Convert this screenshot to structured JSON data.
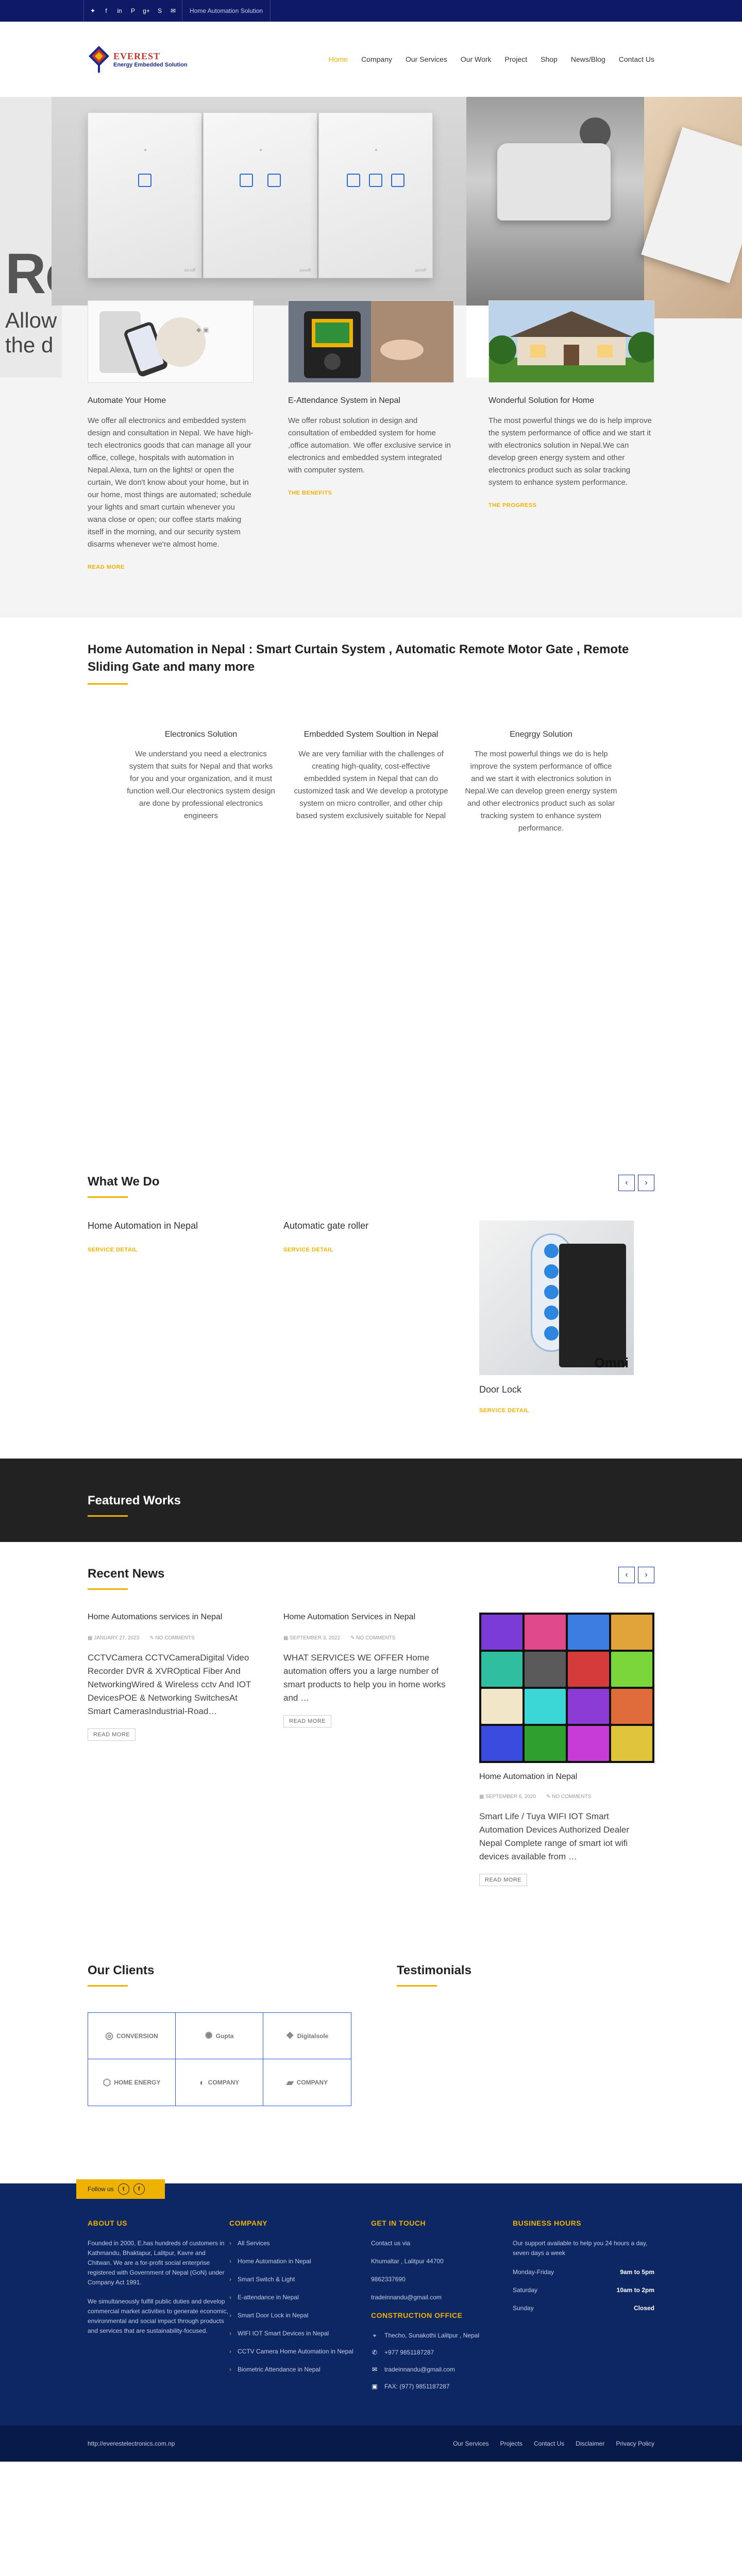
{
  "topbar": {
    "social_icons": [
      "twitter-icon",
      "facebook-icon",
      "linkedin-icon",
      "pinterest-icon",
      "googleplus-icon",
      "skype-icon",
      "email-icon"
    ],
    "social_glyphs": [
      "✦",
      "f",
      "in",
      "P",
      "g+",
      "S",
      "✉"
    ],
    "tagline": "Home Automation Solution"
  },
  "header": {
    "logo_title": "EVEREST",
    "logo_subtitle": "Energy Embedded Solution",
    "nav": [
      "Home",
      "Company",
      "Our Services",
      "Our Work",
      "Project",
      "Shop",
      "News/Blog",
      "Contact Us"
    ],
    "active_nav": "Home"
  },
  "hero": {
    "headline": "Re",
    "subline1": "Allow",
    "subline2": "the d",
    "switch_brand": "sonoff"
  },
  "features": [
    {
      "title": "Automate Your Home",
      "text": "We offer all electronics and embedded system design and consultation in Nepal. We have high-tech electronics goods that can manage all your office, college, hospitals with automation in Nepal.Alexa, turn on the lights! or open the curtain, We don't know about your home, but in our home, most things are automated; schedule your lights and smart curtain whenever you wana close or open; our coffee starts making itself in the morning, and our security system disarms whenever we're almost home.",
      "link": "READ MORE"
    },
    {
      "title": "E-Attendance System in Nepal",
      "text": "We offer robust solution in design and consultation of embedded system for home ,office automation. We offer exclusive service in electronics and embedded system integrated with computer system.",
      "link": "THE BENEFITS"
    },
    {
      "title": "Wonderful Solution for Home",
      "text": "The most powerful things we do is help improve the system performance of office and we start it with electronics solution in Nepal.We can develop green energy system and other electronics product such as solar tracking system to enhance system performance.",
      "link": "THE PROGRESS"
    }
  ],
  "about": {
    "heading": "Home Automation in Nepal : Smart Curtain System , Automatic Remote Motor Gate , Remote Sliding Gate and many more",
    "columns": [
      {
        "title": "Electronics Solution",
        "text": "We understand you need a electronics system that suits for Nepal and that works for you and your organization, and it must function well.Our electronics system design are done by professional electronics engineers"
      },
      {
        "title": "Embedded System Soultion in Nepal",
        "text": "We are very familiar with the challenges of creating high-quality, cost-effective embedded system in Nepal that can do customized task and We develop a prototype system on micro controller, and other chip based system exclusively suitable for Nepal"
      },
      {
        "title": "Enegrgy Solution",
        "text": "The most powerful things we do is help improve the system performance of office and we start it with electronics solution in Nepal.We can develop green energy system and other electronics product such as solar tracking system to enhance system performance."
      }
    ]
  },
  "what_we_do": {
    "title": "What We Do",
    "items": [
      {
        "title": "Home Automation in Nepal",
        "link": "SERVICE DETAIL"
      },
      {
        "title": "Automatic gate roller",
        "link": "SERVICE DETAIL"
      },
      {
        "title": "Door Lock",
        "link": "SERVICE DETAIL",
        "image_label": "Omni"
      }
    ],
    "prev": "‹",
    "next": "›"
  },
  "featured_works": {
    "title": "Featured Works"
  },
  "recent_news": {
    "title": "Recent News",
    "items": [
      {
        "title": "Home Automations services in Nepal",
        "date": "JANUARY 27, 2023",
        "comments": "NO COMMENTS",
        "text": "CCTVCamera CCTVCameraDigital Video Recorder DVR & XVROptical Fiber And NetworkingWired & Wireless cctv And IOT DevicesPOE & Networking SwitchesAt Smart CamerasIndustrial-Road…",
        "button": "READ MORE"
      },
      {
        "title": "Home Automation Services in Nepal",
        "date": "SEPTEMBER 3, 2022",
        "comments": "NO COMMENTS",
        "text": "WHAT SERVICES WE OFFER Home automation offers you a large number of smart products to help you in home works and …",
        "button": "READ MORE"
      },
      {
        "title": "Home Automation in Nepal",
        "date": "SEPTEMBER 6, 2020",
        "comments": "NO COMMENTS",
        "text": "Smart Life / Tuya WIFI IOT Smart Automation Devices  Authorized Dealer Nepal Complete range of smart iot wifi devices available from …",
        "button": "READ MORE"
      }
    ]
  },
  "clients": {
    "title": "Our Clients",
    "logos": [
      "CONVERSION",
      "Gupta",
      "Digitalsole",
      "HOME ENERGY",
      "COMPANY",
      "COMPANY"
    ]
  },
  "testimonials": {
    "title": "Testimonials"
  },
  "footer": {
    "follow_label": "Follow us",
    "follow_icons": [
      "t",
      "f"
    ],
    "about": {
      "title": "ABOUT US",
      "p1": "Founded in 2000, E.has hundreds of customers in Kathmandu, Bhaktapur, Lalitpur, Kavre and Chitwan. We are a for-profit social enterprise registered with Government of Nepal (GoN) under Company Act 1991.",
      "p2": "We simultaneously fulfill public duties and develop commercial market activities to generate economic, environmental and social impact through products and services that are sustainability-focused."
    },
    "company": {
      "title": "COMPANY",
      "links": [
        "All Services",
        "Home Automation in Nepal",
        "Smart Switch & Light",
        "E-attendance in Nepal",
        "Smart Door Lock in Nepal",
        "WIFI IOT Smart Devices in Nepal",
        "CCTV Camera Home Automation in Nepal",
        "Biometric Attendance in Nepal"
      ]
    },
    "contact": {
      "title": "GET IN TOUCH",
      "lines": [
        "Contact us via",
        "Khumaltar , Lalitpur 44700",
        "9862337690",
        "tradeinnandu@gmail.com"
      ],
      "construction_title": "CONSTRUCTION OFFICE",
      "address": "Thecho, Sunakothi Lalitpur , Nepal",
      "phone": "+977 9851187287",
      "email": "tradeinnandu@gmail.com",
      "fax": "FAX: (977) 9851187287"
    },
    "hours": {
      "title": "BUSINESS HOURS",
      "intro": "Our support available to help you 24 hours a day, seven days a week",
      "rows": [
        {
          "day": "Monday-Friday",
          "time": "9am to 5pm"
        },
        {
          "day": "Saturday",
          "time": "10am to 2pm"
        },
        {
          "day": "Sunday",
          "time": "Closed"
        }
      ]
    }
  },
  "bottombar": {
    "url": "http://everestelectronics.com.np",
    "links": [
      "Our Services",
      "Projects",
      "Contact Us",
      "Disclaimer",
      "Privacy Policy"
    ]
  },
  "colors": {
    "topbar": "#0e1a66",
    "accent": "#f0b200",
    "footer": "#0d2765",
    "dark_band": "#222222",
    "button_blue": "#2b6cd6"
  }
}
